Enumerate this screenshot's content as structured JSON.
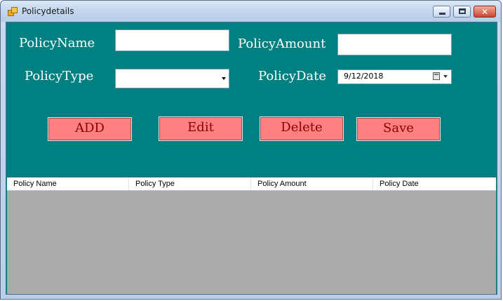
{
  "window": {
    "title": "Policydetails"
  },
  "form": {
    "policy_name_label": "PolicyName",
    "policy_name_value": "",
    "policy_amount_label": "PolicyAmount",
    "policy_amount_value": "",
    "policy_type_label": "PolicyType",
    "policy_type_selected": "",
    "policy_date_label": "PolicyDate",
    "policy_date_value": "9/12/2018"
  },
  "buttons": {
    "add": "ADD",
    "edit": "Edit",
    "delete": "Delete",
    "save": "Save"
  },
  "grid": {
    "columns": [
      "Policy Name",
      "Policy Type",
      "Policy Amount",
      "Policy Date"
    ],
    "rows": []
  },
  "colors": {
    "background": "#008080",
    "button": "#ff8080",
    "button_text": "#8b0000",
    "grid_empty": "#ababab"
  }
}
